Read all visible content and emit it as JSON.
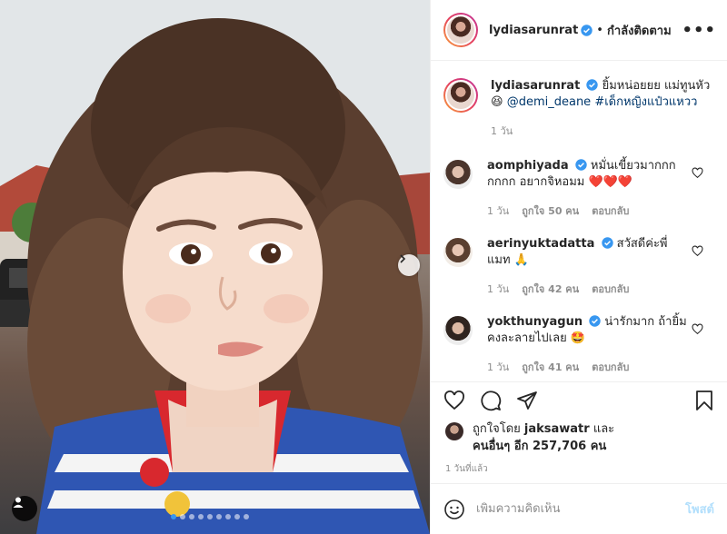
{
  "post": {
    "author": "lydiasarunrat",
    "follow_state": "กำลังติดตาม",
    "separator": "•",
    "more": "•••",
    "caption_text": "ยิ้มหน่อยยย แม่ทูนหัว 😆",
    "caption_mention": "@demi_deane",
    "caption_hashtag": "#เด็กหญิงแป๋วแหวว",
    "caption_time": "1 วัน"
  },
  "comments": [
    {
      "username": "aomphiyada",
      "text": "หมั่นเขี้ยวมากกกกกกก อยากจิหอมม ❤️❤️❤️",
      "time": "1 วัน",
      "likes": "ถูกใจ 50 คน",
      "reply": "ตอบกลับ"
    },
    {
      "username": "aerinyuktadatta",
      "text": "สวัสดีค่ะพี่แมท 🙏",
      "time": "1 วัน",
      "likes": "ถูกใจ 42 คน",
      "reply": "ตอบกลับ"
    },
    {
      "username": "yokthunyagun",
      "text": "น่ารักมาก ถ้ายิ้มคงละลายไปเลย 🤩",
      "time": "1 วัน",
      "likes": "ถูกใจ 41 คน",
      "reply": "ตอบกลับ"
    }
  ],
  "likes": {
    "prefix": "ถูกใจโดย",
    "user": "jaksawatr",
    "and": "และ",
    "others": "คนอื่นๆ อีก 257,706 คน"
  },
  "post_time": "1 วันที่แล้ว",
  "comment_box": {
    "placeholder": "เพิ่มความคิดเห็น",
    "post_label": "โพสต์"
  },
  "icons": {
    "verified": "verified-badge",
    "like": "heart-icon",
    "comment": "comment-icon",
    "share": "share-icon",
    "save": "bookmark-icon",
    "emoji": "emoji-icon",
    "next": "chevron-right-icon",
    "tag": "user-icon"
  },
  "colors": {
    "verified": "#3897f0",
    "link": "#00376b",
    "muted": "#8e8e8e",
    "post_disabled": "#b2dffc",
    "active_dot": "#3897f0"
  },
  "carousel": {
    "total": 9,
    "active": 1
  }
}
